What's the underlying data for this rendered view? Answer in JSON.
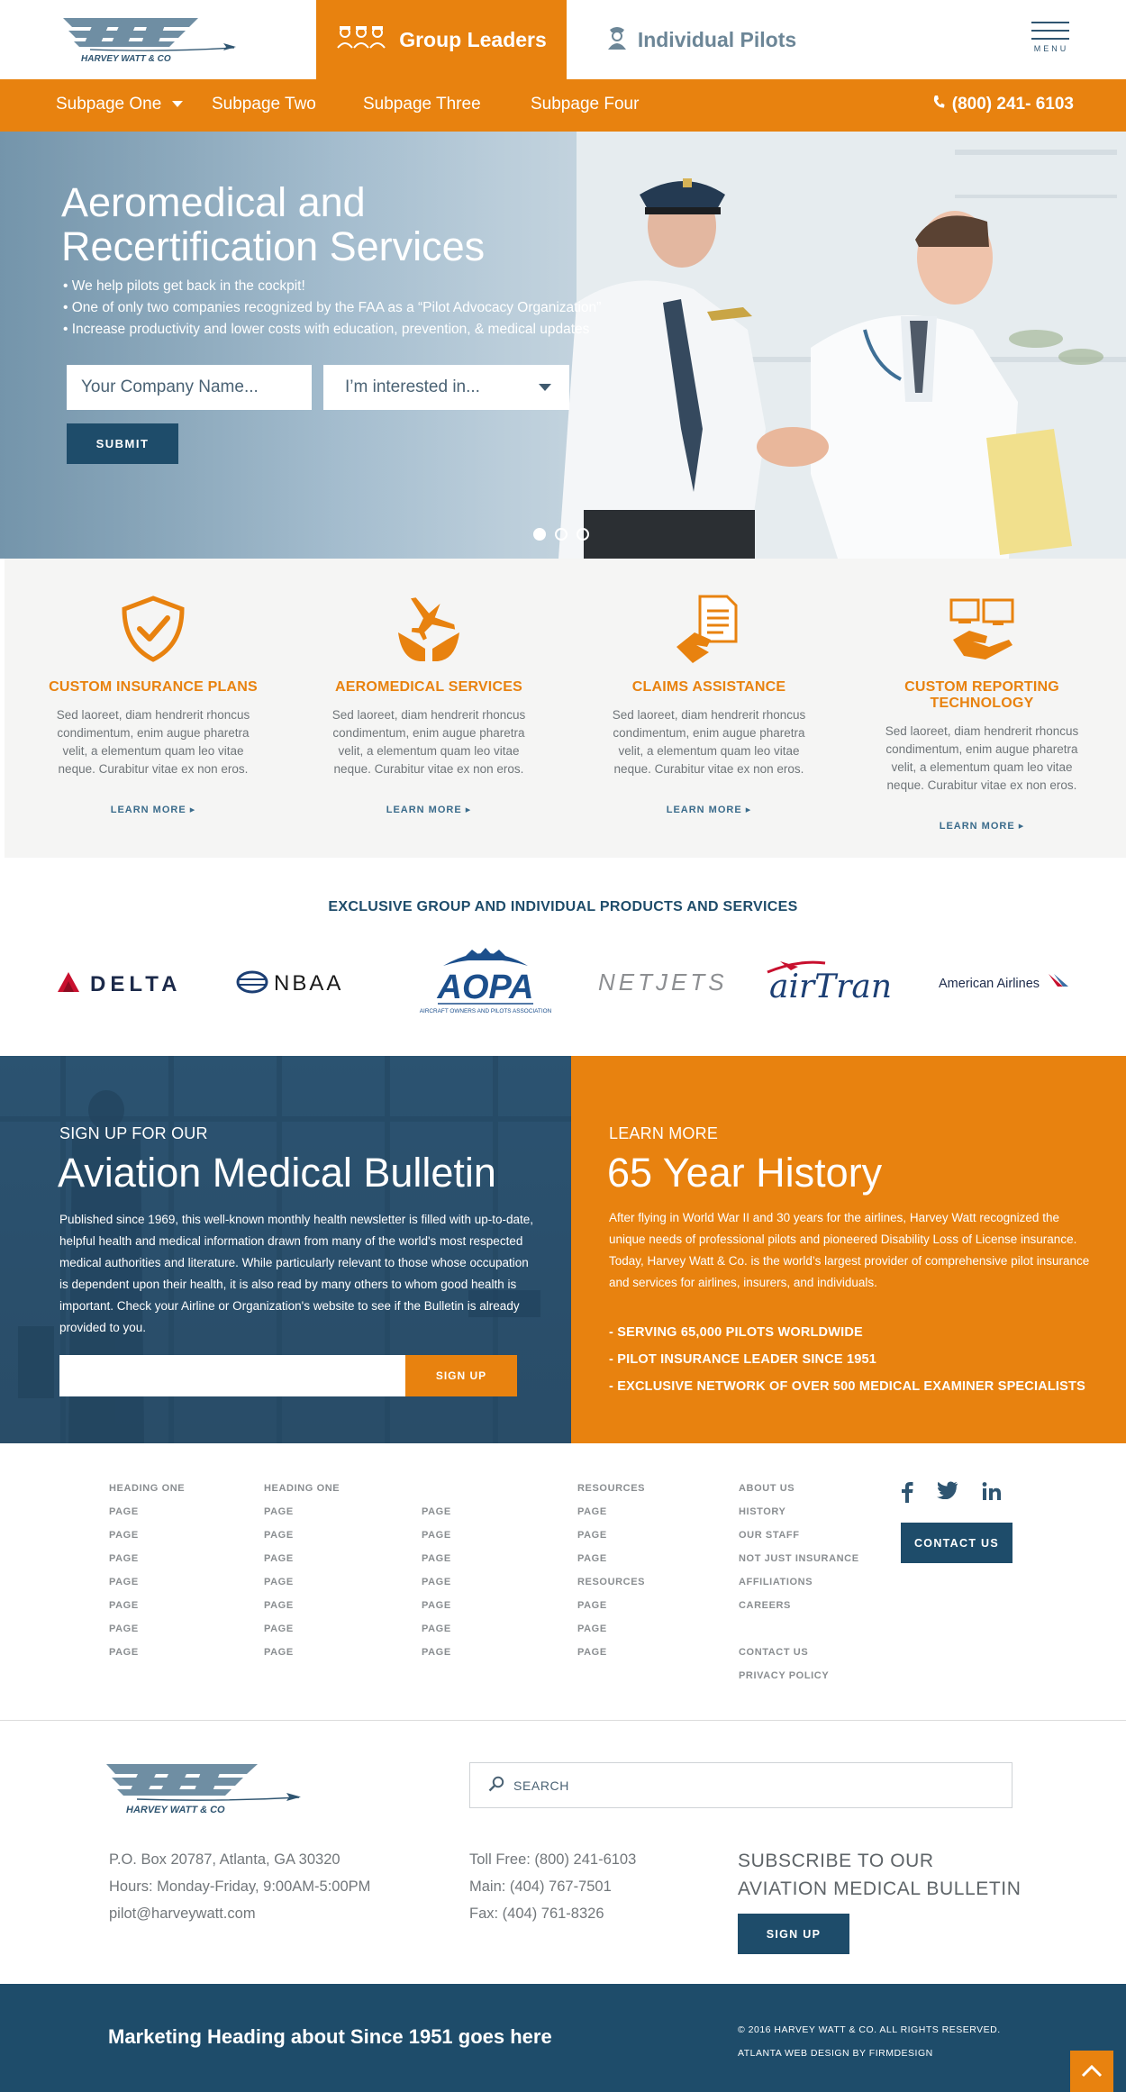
{
  "header": {
    "logo_text": "HARVEY WATT & CO",
    "tabs": [
      {
        "label": "Group Leaders",
        "icon": "group-icon"
      },
      {
        "label": "Individual Pilots",
        "icon": "pilot-icon"
      }
    ],
    "menu_label": "MENU"
  },
  "nav": {
    "items": [
      "Subpage One",
      "Subpage Two",
      "Subpage Three",
      "Subpage Four"
    ],
    "phone": "(800) 241- 6103"
  },
  "hero": {
    "title_line1": "Aeromedical and",
    "title_line2": "Recertification Services",
    "bullets": [
      "• We help pilots get back in the cockpit!",
      "• One of only two companies recognized by the FAA as a “Pilot Advocacy Organization”",
      "• Increase productivity and lower costs with education, prevention, & medical updates"
    ],
    "company_placeholder": "Your Company Name...",
    "interest_placeholder": "I’m interested in...",
    "submit_label": "SUBMIT",
    "slides_total": 3,
    "active_slide": 1
  },
  "services": [
    {
      "title": "CUSTOM INSURANCE PLANS",
      "icon": "shield-check-icon",
      "body": "Sed laoreet, diam hendrerit rhoncus condimentum, enim augue pharetra velit, a elementum quam leo vitae neque. Curabitur vitae ex non eros.",
      "link": "LEARN MORE"
    },
    {
      "title": "AEROMEDICAL SERVICES",
      "icon": "plane-hands-icon",
      "body": "Sed laoreet, diam hendrerit rhoncus condimentum, enim augue pharetra velit, a elementum quam leo vitae neque. Curabitur vitae ex non eros.",
      "link": "LEARN MORE"
    },
    {
      "title": "CLAIMS ASSISTANCE",
      "icon": "document-hand-icon",
      "body": "Sed laoreet, diam hendrerit rhoncus condimentum, enim augue pharetra velit, a elementum quam leo vitae neque. Curabitur vitae ex non eros.",
      "link": "LEARN MORE"
    },
    {
      "title": "CUSTOM REPORTING TECHNOLOGY",
      "icon": "devices-hand-icon",
      "body": "Sed laoreet, diam hendrerit rhoncus condimentum, enim augue pharetra velit, a elementum quam leo vitae neque. Curabitur vitae ex non eros.",
      "link": "LEARN MORE"
    }
  ],
  "partners": {
    "title": "EXCLUSIVE GROUP AND  INDIVIDUAL PRODUCTS AND SERVICES",
    "logos": [
      "DELTA",
      "NBAA",
      "AOPA",
      "AIRCRAFT OWNERS AND PILOTS ASSOCIATION",
      "NETJETS",
      "airTran",
      "American Airlines"
    ]
  },
  "bulletin": {
    "eyebrow": "SIGN UP FOR OUR",
    "title": "Aviation Medical Bulletin",
    "body": "Published since 1969, this well-known monthly health newsletter is filled with up-to-date, helpful health and medical information drawn from many of the world's most respected medical authorities and literature. While particularly relevant to those whose occupation is dependent upon their health, it is also read by many others to whom good health is important.  Check your Airline or Organization's website to see if the Bulletin is already provided to you.",
    "button": "SIGN UP"
  },
  "history": {
    "eyebrow": "LEARN MORE",
    "title": "65 Year History",
    "body": "After flying in World War II and 30 years for the airlines, Harvey Watt recognized the unique needs of professional pilots and pioneered Disability Loss of License insurance. Today, Harvey Watt & Co. is the world’s largest provider of comprehensive pilot insurance and services for airlines, insurers, and individuals.",
    "stats": [
      "- SERVING 65,000 PILOTS WORLDWIDE",
      "- PILOT INSURANCE LEADER SINCE 1951",
      "- EXCLUSIVE NETWORK OF OVER 500 MEDICAL EXAMINER SPECIALISTS"
    ]
  },
  "footer_links": {
    "col1": [
      "HEADING ONE",
      "PAGE",
      "PAGE",
      "PAGE",
      "PAGE",
      "PAGE",
      "PAGE",
      "PAGE"
    ],
    "col2": [
      "HEADING ONE",
      "PAGE",
      "PAGE",
      "PAGE",
      "PAGE",
      "PAGE",
      "PAGE",
      "PAGE"
    ],
    "col3": [
      "PAGE",
      "PAGE",
      "PAGE",
      "PAGE",
      "PAGE",
      "PAGE",
      "PAGE"
    ],
    "col4": [
      "RESOURCES",
      "PAGE",
      "PAGE",
      "PAGE",
      "RESOURCES",
      "PAGE",
      "PAGE",
      "PAGE"
    ],
    "col5": [
      "ABOUT US",
      "HISTORY",
      "OUR STAFF",
      "NOT JUST INSURANCE",
      "AFFILIATIONS",
      "CAREERS"
    ],
    "col5b": [
      "CONTACT US",
      "PRIVACY POLICY"
    ],
    "social": [
      "facebook-icon",
      "twitter-icon",
      "linkedin-icon"
    ],
    "contact_button": "CONTACT US"
  },
  "footer": {
    "logo_text": "HARVEY WATT & CO",
    "search_placeholder": "SEARCH",
    "address": [
      "P.O. Box 20787, Atlanta, GA 30320",
      "Hours: Monday-Friday, 9:00AM-5:00PM",
      "pilot@harveywatt.com"
    ],
    "phones": [
      "Toll Free: (800) 241-6103",
      "Main: (404) 767-7501",
      "Fax: (404) 761-8326"
    ],
    "subscribe_line1": "SUBSCRIBE TO OUR",
    "subscribe_line2": "AVIATION MEDICAL BULLETIN",
    "subscribe_button": "SIGN UP",
    "marketing": "Marketing Heading about Since 1951 goes here",
    "copyright": "© 2016 HARVEY WATT & CO. ALL RIGHTS RESERVED.",
    "credit": "ATLANTA WEB DESIGN BY FIRMDESIGN"
  },
  "colors": {
    "orange": "#e8820f",
    "navy": "#1e4c6a",
    "steel": "#6c8697"
  }
}
